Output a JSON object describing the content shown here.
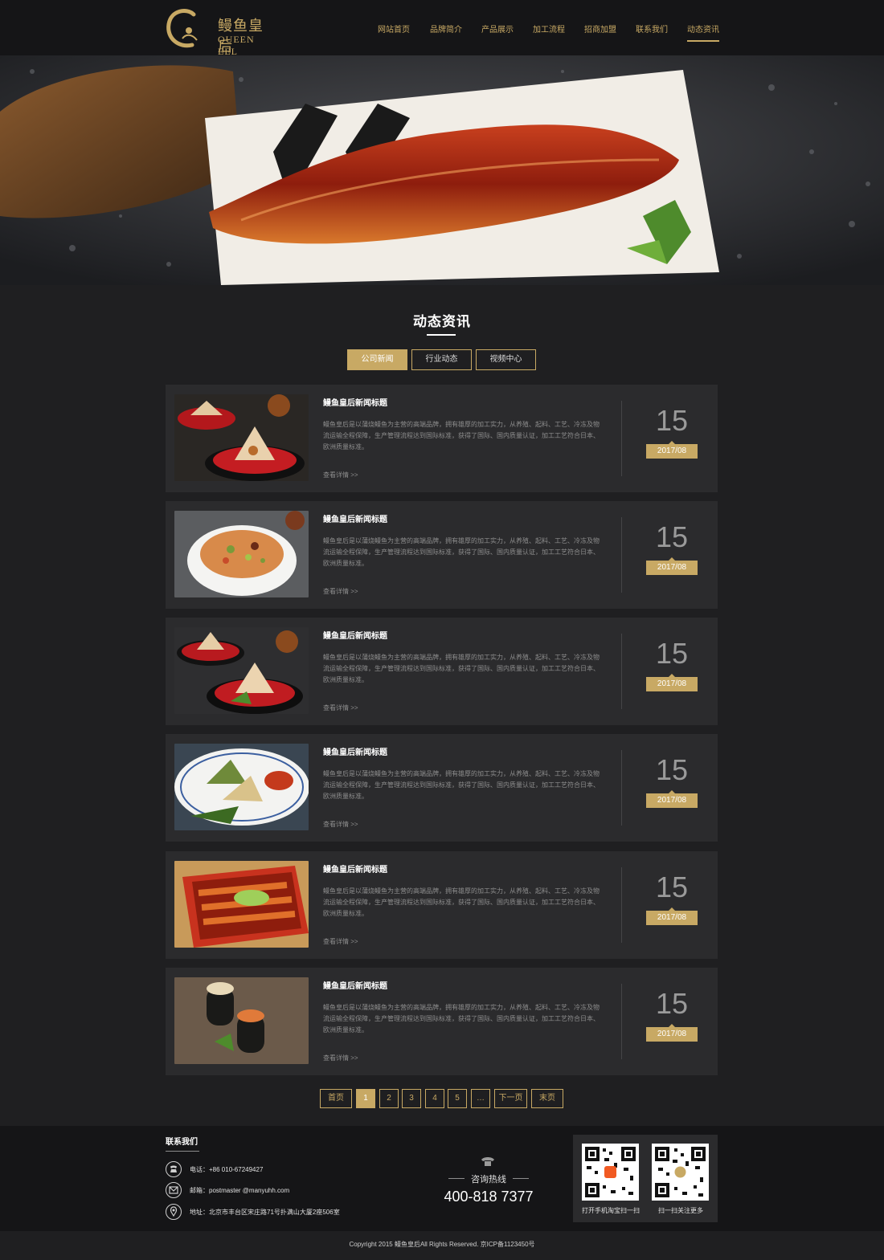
{
  "brand": {
    "name_cn": "鳗鱼皇后",
    "name_en": "QUEEN EEL"
  },
  "nav": {
    "items": [
      {
        "label": "网站首页"
      },
      {
        "label": "品牌简介"
      },
      {
        "label": "产品展示"
      },
      {
        "label": "加工流程"
      },
      {
        "label": "招商加盟"
      },
      {
        "label": "联系我们"
      },
      {
        "label": "动态资讯",
        "active": true
      }
    ]
  },
  "section": {
    "title": "动态资讯",
    "tabs": [
      {
        "label": "公司新闻",
        "active": true
      },
      {
        "label": "行业动态"
      },
      {
        "label": "视频中心"
      }
    ]
  },
  "news": [
    {
      "title": "鳗鱼皇后新闻标题",
      "desc": "鳗鱼皇后是以蒲烧鳗鱼为主营的高端品牌，拥有雄厚的加工实力，从养殖、起料、工艺、冷冻及物流运输全程保障，生产管理流程达到国际标准，获得了国际、国内质量认证，加工工艺符合日本、欧洲质量标准。",
      "more": "查看详情 >>",
      "day": "15",
      "month": "2017/08",
      "image": "onigiri-red-plate"
    },
    {
      "title": "鳗鱼皇后新闻标题",
      "desc": "鳗鱼皇后是以蒲烧鳗鱼为主营的高端品牌，拥有雄厚的加工实力，从养殖、起料、工艺、冷冻及物流运输全程保障，生产管理流程达到国际标准，获得了国际、国内质量认证，加工工艺符合日本、欧洲质量标准。",
      "more": "查看详情 >>",
      "day": "15",
      "month": "2017/08",
      "image": "fried-rice-bowl"
    },
    {
      "title": "鳗鱼皇后新闻标题",
      "desc": "鳗鱼皇后是以蒲烧鳗鱼为主营的高端品牌，拥有雄厚的加工实力，从养殖、起料、工艺、冷冻及物流运输全程保障，生产管理流程达到国际标准，获得了国际、国内质量认证，加工工艺符合日本、欧洲质量标准。",
      "more": "查看详情 >>",
      "day": "15",
      "month": "2017/08",
      "image": "onigiri-black-plate"
    },
    {
      "title": "鳗鱼皇后新闻标题",
      "desc": "鳗鱼皇后是以蒲烧鳗鱼为主营的高端品牌，拥有雄厚的加工实力，从养殖、起料、工艺、冷冻及物流运输全程保障，生产管理流程达到国际标准，获得了国际、国内质量认证，加工工艺符合日本、欧洲质量标准。",
      "more": "查看详情 >>",
      "day": "15",
      "month": "2017/08",
      "image": "zongzi-plate"
    },
    {
      "title": "鳗鱼皇后新闻标题",
      "desc": "鳗鱼皇后是以蒲烧鳗鱼为主营的高端品牌，拥有雄厚的加工实力，从养殖、起料、工艺、冷冻及物流运输全程保障，生产管理流程达到国际标准，获得了国际、国内质量认证，加工工艺符合日本、欧洲质量标准。",
      "more": "查看详情 >>",
      "day": "15",
      "month": "2017/08",
      "image": "unagi-box"
    },
    {
      "title": "鳗鱼皇后新闻标题",
      "desc": "鳗鱼皇后是以蒲烧鳗鱼为主营的高端品牌，拥有雄厚的加工实力，从养殖、起料、工艺、冷冻及物流运输全程保障，生产管理流程达到国际标准，获得了国际、国内质量认证，加工工艺符合日本、欧洲质量标准。",
      "more": "查看详情 >>",
      "day": "15",
      "month": "2017/08",
      "image": "sushi-rolls"
    }
  ],
  "pager": {
    "first": "首页",
    "pages": [
      "1",
      "2",
      "3",
      "4",
      "5",
      "…"
    ],
    "current": "1",
    "next": "下一页",
    "last": "末页"
  },
  "footer": {
    "title": "联系我们",
    "phone": "电话：+86 010-67249427",
    "email": "邮箱：postmaster @manyuhh.com",
    "address": "地址：北京市丰台区宋庄路71号扑满山大厦2座506室",
    "hotline_label": "咨询热线",
    "hotline_number": "400-818 7377",
    "qr_left_caption": "打开手机淘宝扫一扫",
    "qr_right_caption": "扫一扫关注更多",
    "icons": {
      "phone": "phone-icon",
      "email": "mail-icon",
      "address": "location-icon",
      "hotline": "telephone-icon"
    }
  },
  "copyright": "Copyright 2015 鳗鱼皇后All Rights Reserved. 京ICP备1123450号",
  "colors": {
    "accent": "#c8a964",
    "background": "#1f1f21",
    "card": "#2b2b2d",
    "header": "#151517"
  }
}
